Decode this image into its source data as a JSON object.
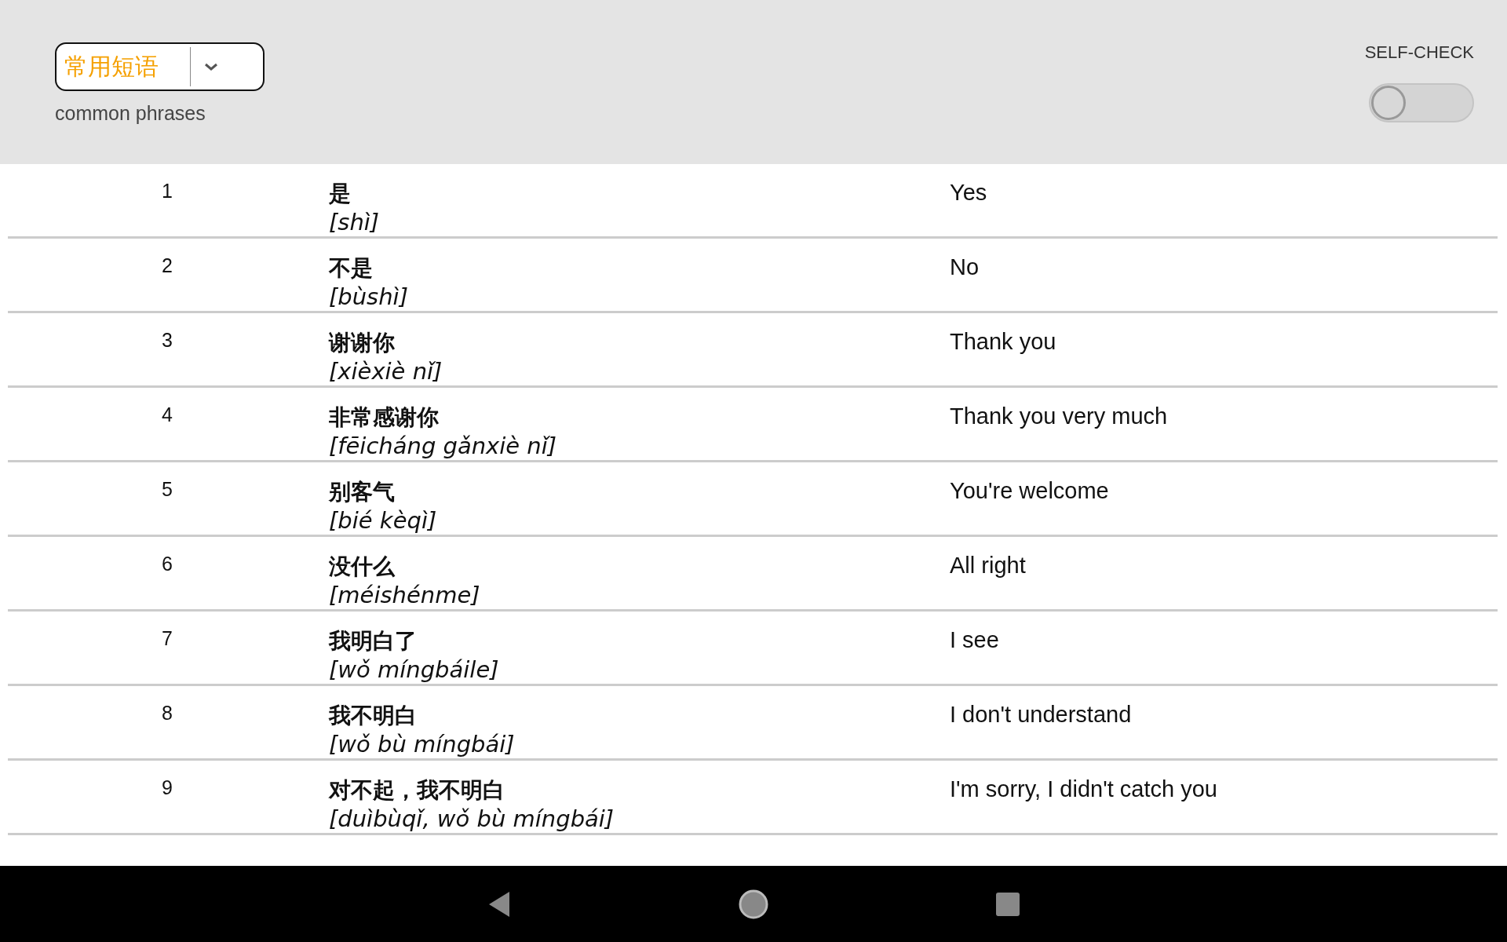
{
  "header": {
    "category_dropdown": {
      "value": "常用短语"
    },
    "category_subtitle": "common phrases",
    "self_check": {
      "label": "SELF-CHECK",
      "on": false
    }
  },
  "phrases": [
    {
      "number": "1",
      "hanzi": "是",
      "pinyin": "[shì]",
      "english": "Yes"
    },
    {
      "number": "2",
      "hanzi": "不是",
      "pinyin": "[bùshì]",
      "english": "No"
    },
    {
      "number": "3",
      "hanzi": "谢谢你",
      "pinyin": "[xièxiè nǐ]",
      "english": "Thank you"
    },
    {
      "number": "4",
      "hanzi": "非常感谢你",
      "pinyin": "[fēicháng gǎnxiè nǐ]",
      "english": "Thank you very much"
    },
    {
      "number": "5",
      "hanzi": "别客气",
      "pinyin": "[bié kèqì]",
      "english": "You're welcome"
    },
    {
      "number": "6",
      "hanzi": "没什么",
      "pinyin": "[méishénme]",
      "english": "All right"
    },
    {
      "number": "7",
      "hanzi": "我明白了",
      "pinyin": "[wǒ míngbáile]",
      "english": "I see"
    },
    {
      "number": "8",
      "hanzi": "我不明白",
      "pinyin": "[wǒ bù míngbái]",
      "english": "I don't understand"
    },
    {
      "number": "9",
      "hanzi": "对不起，我不明白",
      "pinyin": "[duìbùqǐ, wǒ bù míngbái]",
      "english": "I'm sorry, I didn't catch you"
    }
  ]
}
